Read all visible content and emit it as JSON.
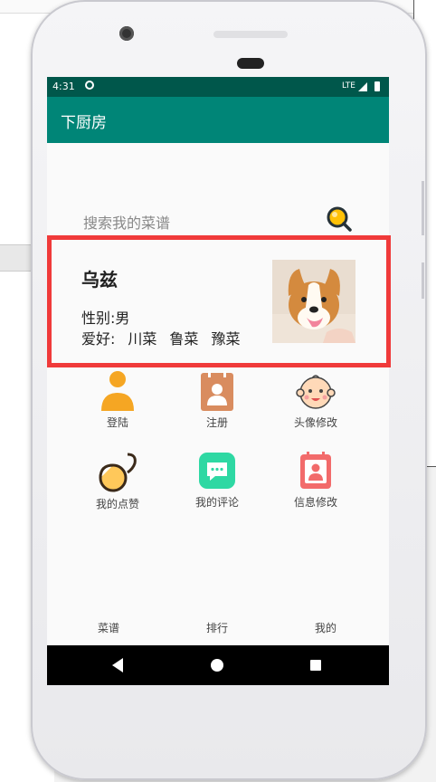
{
  "status_bar": {
    "time": "4:31",
    "network": "LTE"
  },
  "app_bar": {
    "title": "下厨房"
  },
  "search": {
    "placeholder": "搜索我的菜谱"
  },
  "profile": {
    "name": "乌兹",
    "gender": "性别:男",
    "hobby_label": "爱好:",
    "hobbies": [
      "川菜",
      "鲁菜",
      "豫菜"
    ]
  },
  "grid": [
    {
      "label": "登陆",
      "icon": "person-icon"
    },
    {
      "label": "注册",
      "icon": "contact-book-icon"
    },
    {
      "label": "头像修改",
      "icon": "baby-face-icon"
    },
    {
      "label": "我的点赞",
      "icon": "like-bowl-icon"
    },
    {
      "label": "我的评论",
      "icon": "comment-icon"
    },
    {
      "label": "信息修改",
      "icon": "id-card-icon"
    }
  ],
  "bottom_nav": [
    "菜谱",
    "排行",
    "我的"
  ],
  "colors": {
    "status_bar": "#00574b",
    "app_bar": "#008577",
    "highlight_border": "#f03a3a"
  }
}
